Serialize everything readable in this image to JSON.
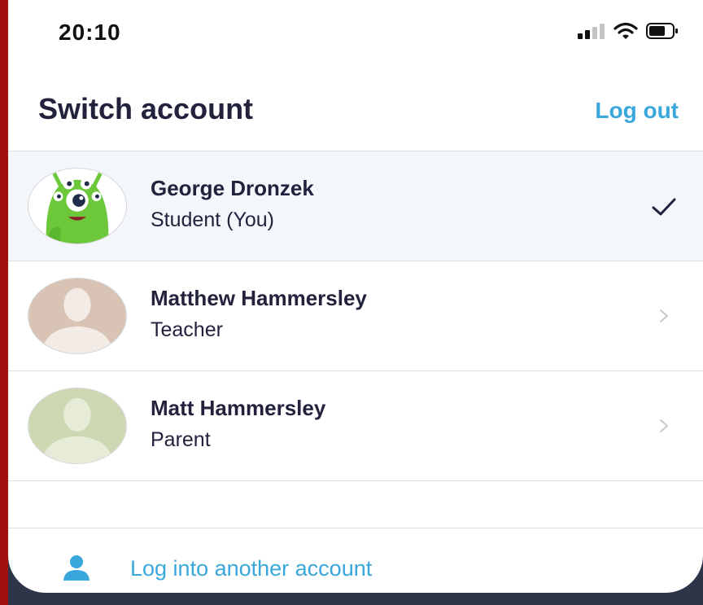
{
  "status_bar": {
    "time": "20:10",
    "icons": [
      "cellular-signal-icon",
      "wifi-icon",
      "battery-icon"
    ]
  },
  "header": {
    "title": "Switch account",
    "logout_label": "Log out"
  },
  "accounts": [
    {
      "name": "George Dronzek",
      "role": "Student (You)",
      "avatar": "green-monster-avatar",
      "selected": true,
      "indicator": "checkmark-icon"
    },
    {
      "name": "Matthew Hammersley",
      "role": "Teacher",
      "avatar": "default-person-avatar",
      "selected": false,
      "indicator": "chevron-right-icon"
    },
    {
      "name": "Matt Hammersley",
      "role": "Parent",
      "avatar": "default-person-avatar",
      "selected": false,
      "indicator": "chevron-right-icon"
    }
  ],
  "footer": {
    "label": "Log into another account",
    "icon": "person-icon"
  },
  "colors": {
    "accent": "#3aa7dc",
    "text_dark": "#22223d",
    "selected_row_bg": "#f3f6fb",
    "divider": "#dedede",
    "monster_green": "#6cc83a",
    "teacher_avatar_bg": "#d8c3b4",
    "parent_avatar_bg": "#ccd8b2",
    "backdrop": "#2e3548",
    "edge_red": "#a3110f"
  }
}
